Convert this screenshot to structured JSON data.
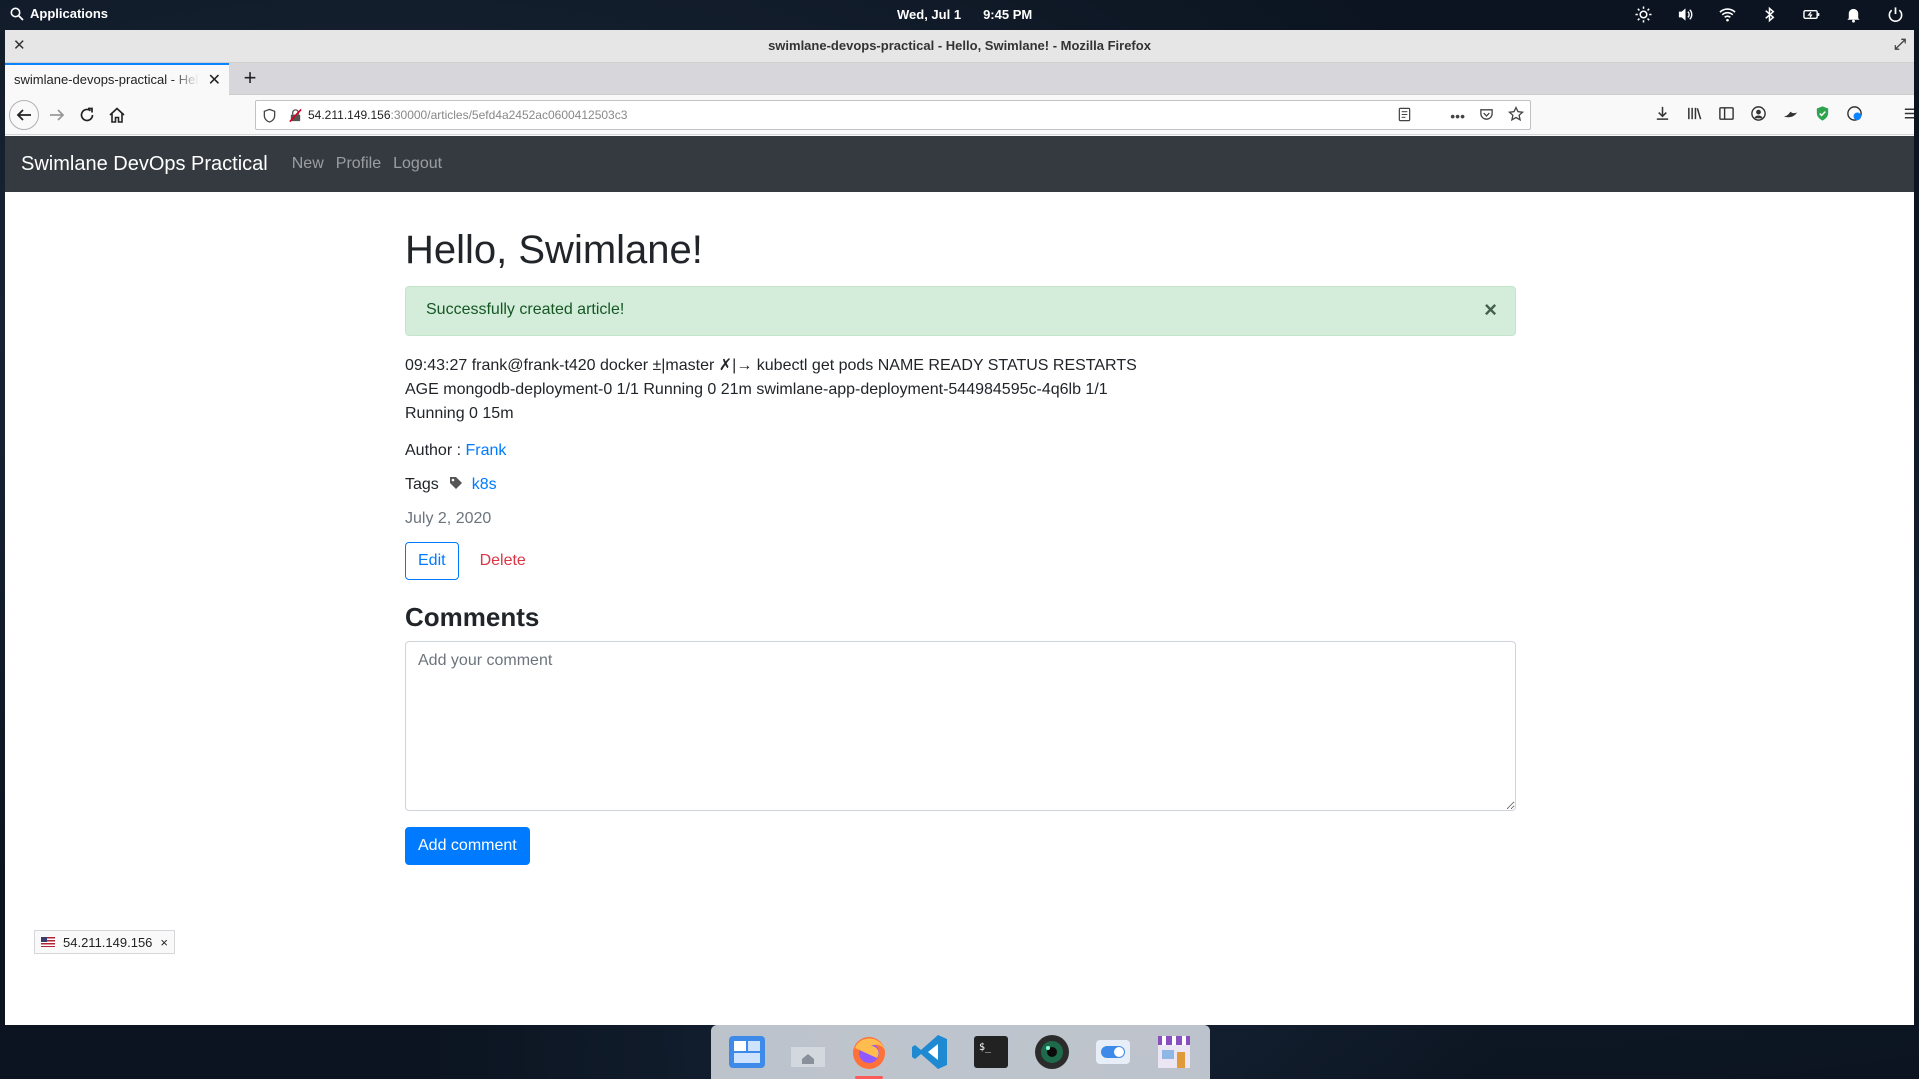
{
  "system_panel": {
    "applications_label": "Applications",
    "date": "Wed, Jul 1",
    "time": "9:45 PM",
    "tray_icons": [
      "brightness-icon",
      "volume-icon",
      "wifi-icon",
      "bluetooth-icon",
      "battery-icon",
      "notifications-icon",
      "power-icon"
    ]
  },
  "window": {
    "title": "swimlane-devops-practical - Hello, Swimlane! - Mozilla Firefox"
  },
  "browser": {
    "tab_title": "swimlane-devops-practical - Hello, Swimlane!",
    "url_host": "54.211.149.156",
    "url_rest": ":30000/articles/5efd4a2452ac0600412503c3",
    "url_more": "•••"
  },
  "app": {
    "brand": "Swimlane DevOps Practical",
    "nav": {
      "new": "New",
      "profile": "Profile",
      "logout": "Logout"
    }
  },
  "article": {
    "title": "Hello, Swimlane!",
    "flash": "Successfully created article!",
    "flash_close": "×",
    "body": "09:43:27 frank@frank-t420 docker ±|master ✗|→ kubectl get pods NAME READY STATUS RESTARTS AGE mongodb-deployment-0 1/1 Running 0 21m swimlane-app-deployment-544984595c-4q6lb 1/1 Running 0 15m",
    "author_label": "Author :",
    "author_name": "Frank",
    "tags_label": "Tags",
    "tag": "k8s",
    "date": "July 2, 2020",
    "edit_label": "Edit",
    "delete_label": "Delete"
  },
  "comments": {
    "heading": "Comments",
    "placeholder": "Add your comment",
    "value": "",
    "submit_label": "Add comment"
  },
  "status_bar": {
    "ip": "54.211.149.156",
    "close": "×"
  },
  "dock": {
    "items": [
      "workspaces",
      "files",
      "firefox",
      "vscode",
      "terminal",
      "camera",
      "settings",
      "app-store"
    ]
  },
  "colors": {
    "navbar_bg": "#343a40",
    "primary": "#007bff",
    "danger": "#dc3545",
    "alert_bg": "#d4edda",
    "alert_text": "#155724"
  }
}
